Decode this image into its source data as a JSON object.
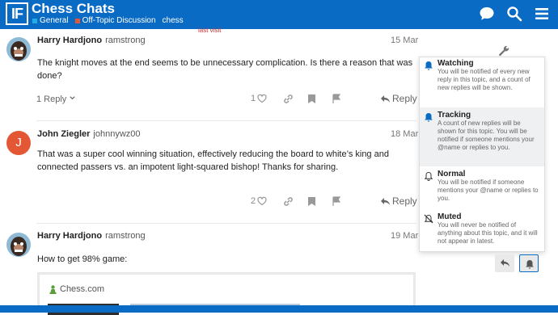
{
  "site": {
    "logo": "IF",
    "title": "Chess Chats"
  },
  "breadcrumbs": [
    {
      "label": "General",
      "color": "#25aae1"
    },
    {
      "label": "Off-Topic Discussion",
      "color": "#e45735"
    },
    {
      "label": "chess",
      "color": ""
    }
  ],
  "last_visit": "last visit",
  "posts": [
    {
      "user": "Harry Hardjono",
      "handle": "ramstrong",
      "date": "15 Mar",
      "body": "The knight moves at the end seems to be unnecessary complication. Is there a reason that was done?",
      "replies": "1 Reply",
      "likes": "1",
      "reply_label": "Reply"
    },
    {
      "user": "John Ziegler",
      "handle": "johnnywz00",
      "date": "18 Mar",
      "avatar_letter": "J",
      "body": "That was a super cool winning situation, effectively reducing the board to white’s king and connected passers vs. an impotent light-squared bishop! Thanks for sharing.",
      "likes": "2",
      "reply_label": "Reply"
    },
    {
      "user": "Harry Hardjono",
      "handle": "ramstrong",
      "date": "19 Mar",
      "body": "How to get 98% game:"
    }
  ],
  "onebox": {
    "source": "Chess.com"
  },
  "notifications": [
    {
      "title": "Watching",
      "desc": "You will be notified of every new reply in this topic, and a count of new replies will be shown."
    },
    {
      "title": "Tracking",
      "desc": "A count of new replies will be shown for this topic. You will be notified if someone mentions your @name or replies to you."
    },
    {
      "title": "Normal",
      "desc": "You will be notified if someone mentions your @name or replies to you."
    },
    {
      "title": "Muted",
      "desc": "You will never be notified of anything about this topic, and it will not appear in latest."
    }
  ],
  "colors": {
    "header": "#0a6bc5",
    "accent": "#0a6bc5",
    "avatar_j": "#e45735"
  }
}
